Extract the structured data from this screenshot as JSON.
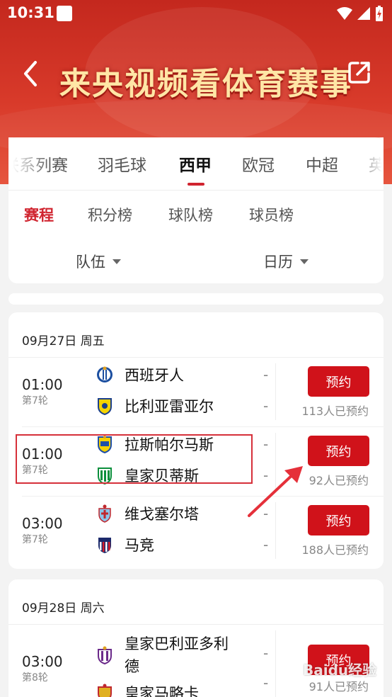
{
  "status_bar": {
    "time": "10:31"
  },
  "header": {
    "title": "来央视频看体育赛事"
  },
  "sport_tabs": [
    {
      "label": "联系列赛"
    },
    {
      "label": "羽毛球"
    },
    {
      "label": "西甲"
    },
    {
      "label": "欧冠"
    },
    {
      "label": "中超"
    },
    {
      "label": "英"
    }
  ],
  "sub_tabs": [
    {
      "label": "赛程"
    },
    {
      "label": "积分榜"
    },
    {
      "label": "球队榜"
    },
    {
      "label": "球员榜"
    }
  ],
  "filters": {
    "team": "队伍",
    "calendar": "日历"
  },
  "days": [
    {
      "date": "09月27日 周五",
      "matches": [
        {
          "time": "01:00",
          "round": "第7轮",
          "home": "西班牙人",
          "away": "比利亚雷亚尔",
          "home_score": "-",
          "away_score": "-",
          "button": "预约",
          "count": "113人已预约"
        },
        {
          "time": "01:00",
          "round": "第7轮",
          "home": "拉斯帕尔马斯",
          "away": "皇家贝蒂斯",
          "home_score": "-",
          "away_score": "-",
          "button": "预约",
          "count": "92人已预约"
        },
        {
          "time": "03:00",
          "round": "第7轮",
          "home": "维戈塞尔塔",
          "away": "马竞",
          "home_score": "-",
          "away_score": "-",
          "button": "预约",
          "count": "188人已预约"
        }
      ]
    },
    {
      "date": "09月28日 周六",
      "matches": [
        {
          "time": "03:00",
          "round": "第8轮",
          "home": "皇家巴利亚多利",
          "home_line2": "德",
          "away": "皇家马略卡",
          "home_score": "-",
          "away_score": "-",
          "button": "预约",
          "count": "91人已预约"
        }
      ]
    }
  ],
  "watermark": "Baidu经验"
}
